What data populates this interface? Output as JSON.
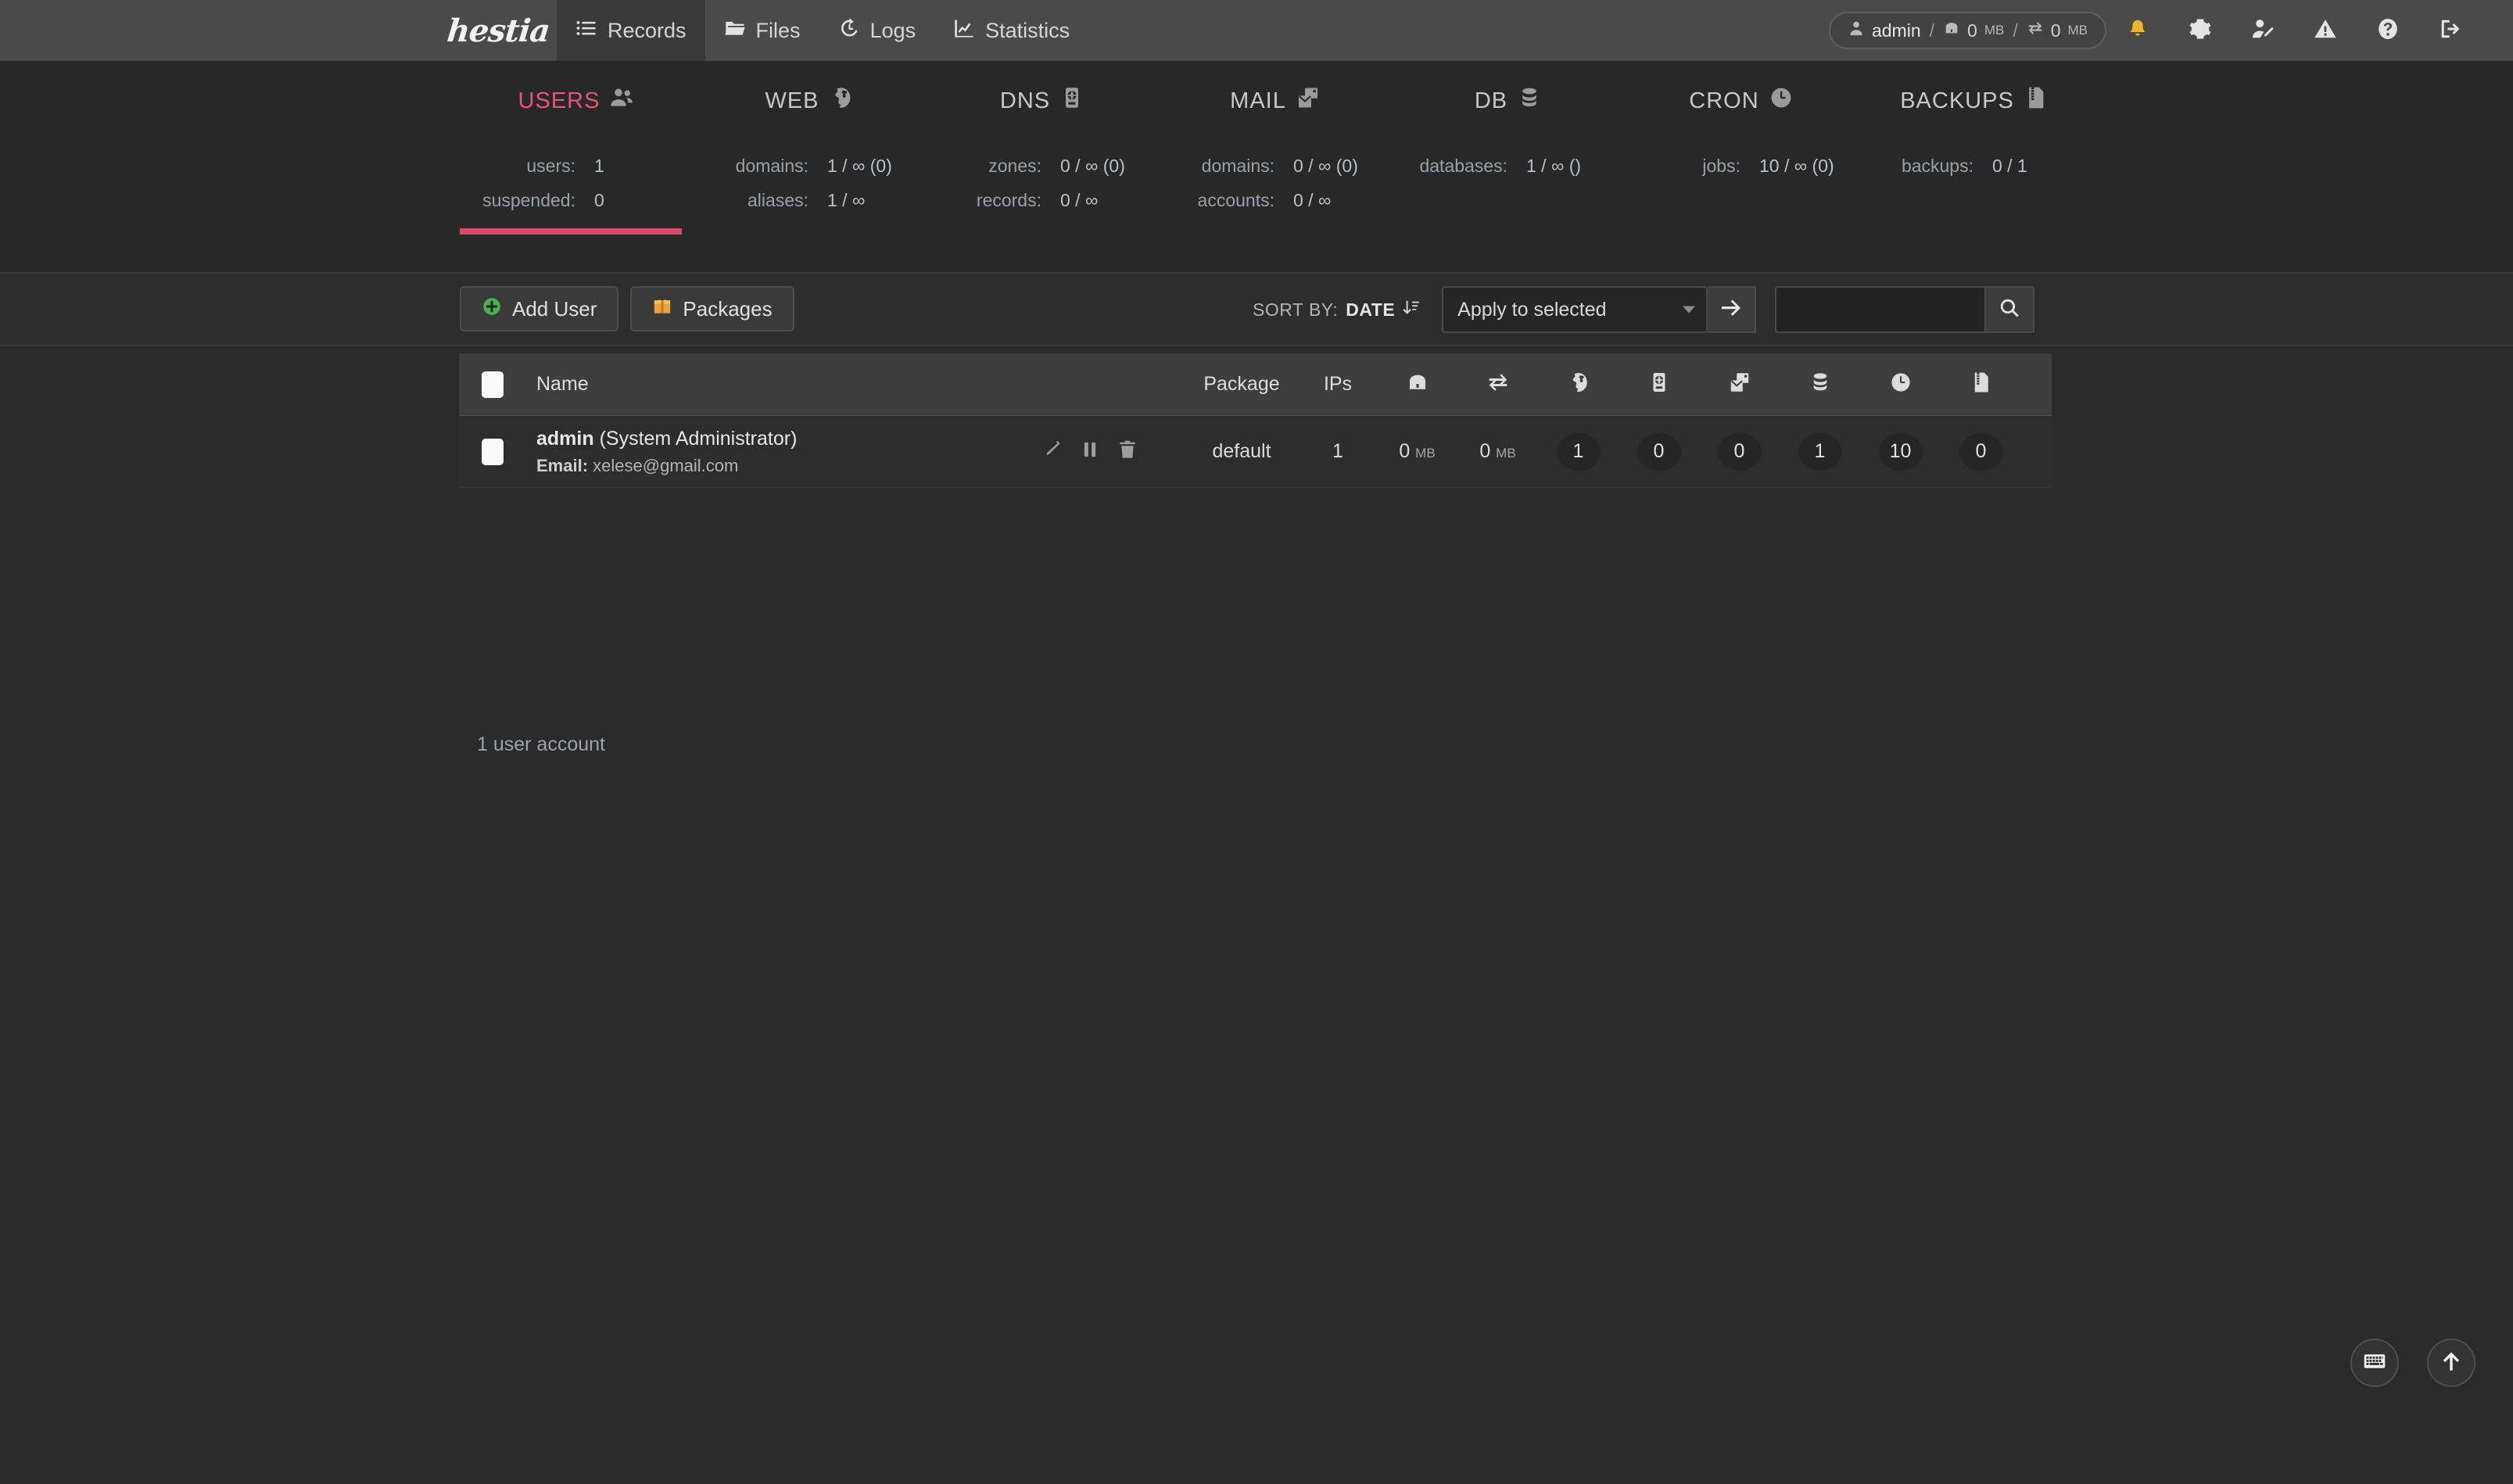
{
  "app": {
    "logo_text": "hestia"
  },
  "nav": {
    "items": [
      {
        "label": "Records",
        "icon": "list-records-icon",
        "active": true
      },
      {
        "label": "Files",
        "icon": "folder-icon",
        "active": false
      },
      {
        "label": "Logs",
        "icon": "history-clock-icon",
        "active": false
      },
      {
        "label": "Statistics",
        "icon": "chart-line-icon",
        "active": false
      }
    ]
  },
  "userbar": {
    "user": "admin",
    "disk": "0",
    "disk_unit": "MB",
    "bandwidth": "0",
    "bandwidth_unit": "MB",
    "sep": "/",
    "icons": [
      {
        "name": "notifications-bell-icon"
      },
      {
        "name": "gear-icon"
      },
      {
        "name": "edit-user-icon"
      },
      {
        "name": "warning-icon"
      },
      {
        "name": "help-icon"
      },
      {
        "name": "logout-icon"
      }
    ]
  },
  "stats": [
    {
      "title": "USERS",
      "icon": "users-icon",
      "active": true,
      "rows": [
        {
          "label": "users:",
          "value": "1"
        },
        {
          "label": "suspended:",
          "value": "0"
        }
      ]
    },
    {
      "title": "WEB",
      "icon": "globe-icon",
      "active": false,
      "rows": [
        {
          "label": "domains:",
          "value": "1 / ∞ (0)"
        },
        {
          "label": "aliases:",
          "value": "1 / ∞"
        }
      ]
    },
    {
      "title": "DNS",
      "icon": "dns-server-icon",
      "active": false,
      "rows": [
        {
          "label": "zones:",
          "value": "0 / ∞ (0)"
        },
        {
          "label": "records:",
          "value": "0 / ∞"
        }
      ]
    },
    {
      "title": "MAIL",
      "icon": "mail-icon",
      "active": false,
      "rows": [
        {
          "label": "domains:",
          "value": "0 / ∞ (0)"
        },
        {
          "label": "accounts:",
          "value": "0 / ∞"
        }
      ]
    },
    {
      "title": "DB",
      "icon": "database-icon",
      "active": false,
      "rows": [
        {
          "label": "databases:",
          "value": "1 / ∞ ()"
        },
        {
          "label": "",
          "value": ""
        }
      ]
    },
    {
      "title": "CRON",
      "icon": "clock-icon",
      "active": false,
      "rows": [
        {
          "label": "jobs:",
          "value": "10 / ∞ (0)"
        },
        {
          "label": "",
          "value": ""
        }
      ]
    },
    {
      "title": "BACKUPS",
      "icon": "archive-icon",
      "active": false,
      "rows": [
        {
          "label": "backups:",
          "value": "0 / 1"
        },
        {
          "label": "",
          "value": ""
        }
      ]
    }
  ],
  "toolbar": {
    "add_user_label": "Add User",
    "packages_label": "Packages",
    "sort_by_label": "SORT BY:",
    "sort_by_value": "DATE",
    "apply_label": "Apply to selected",
    "apply_options": [
      "Apply to selected"
    ],
    "search_value": "",
    "search_placeholder": ""
  },
  "table": {
    "headers": {
      "name": "Name",
      "package": "Package",
      "ips": "IPs",
      "disk_icon": "disk-icon",
      "bandwidth_icon": "bandwidth-icon",
      "web_icon": "globe-icon",
      "dns_icon": "dns-server-icon",
      "mail_icon": "mail-icon",
      "db_icon": "database-icon",
      "cron_icon": "clock-icon",
      "backup_icon": "archive-icon"
    },
    "rows": [
      {
        "username": "admin",
        "fullname": "(System Administrator)",
        "email_label": "Email:",
        "email": "xelese@gmail.com",
        "package": "default",
        "ips": "1",
        "disk": "0",
        "disk_unit": "MB",
        "bandwidth": "0",
        "bandwidth_unit": "MB",
        "web": "1",
        "dns": "0",
        "mail": "0",
        "db": "1",
        "cron": "10",
        "backup": "0"
      }
    ]
  },
  "footer": {
    "count_text": "1 user account"
  },
  "fabs": [
    {
      "name": "keyboard-shortcuts-button",
      "icon": "keyboard-icon"
    },
    {
      "name": "scroll-to-top-button",
      "icon": "arrow-up-icon"
    }
  ],
  "colors": {
    "accent_pink": "#e8547c",
    "underline_pink": "#d9486f",
    "bell_yellow": "#f0b429",
    "add_green": "#4caf50",
    "package_orange": "#e8a33d",
    "bg": "#2a2a2a",
    "topbar": "#4a4a4a"
  }
}
